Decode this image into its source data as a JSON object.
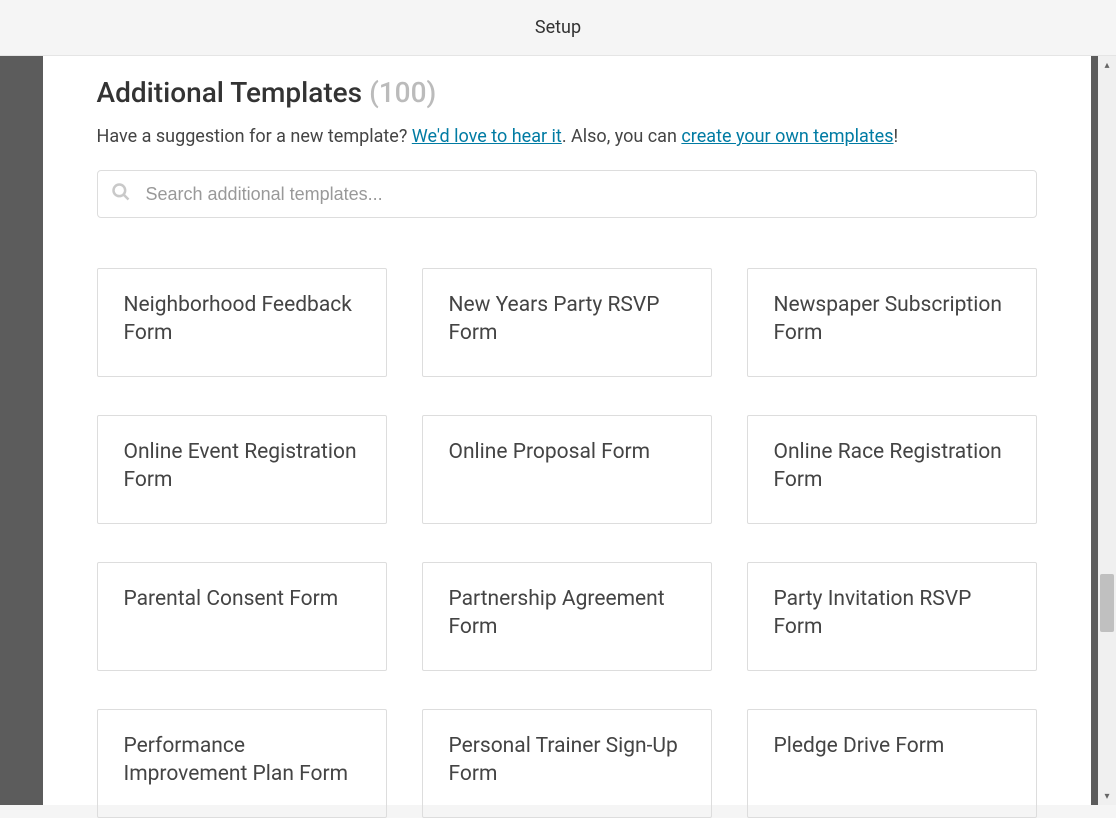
{
  "header": {
    "title": "Setup"
  },
  "page": {
    "heading": "Additional Templates",
    "count": "(100)",
    "subtitle_prefix": "Have a suggestion for a new template? ",
    "subtitle_link1": "We'd love to hear it",
    "subtitle_mid": ". Also, you can ",
    "subtitle_link2": "create your own templates",
    "subtitle_suffix": "!"
  },
  "search": {
    "placeholder": "Search additional templates..."
  },
  "templates": [
    {
      "title": "Neighborhood Feedback Form"
    },
    {
      "title": "New Years Party RSVP Form"
    },
    {
      "title": "Newspaper Subscription Form"
    },
    {
      "title": "Online Event Registration Form"
    },
    {
      "title": "Online Proposal Form"
    },
    {
      "title": "Online Race Registration Form"
    },
    {
      "title": "Parental Consent Form"
    },
    {
      "title": "Partnership Agreement Form"
    },
    {
      "title": "Party Invitation RSVP Form"
    },
    {
      "title": "Performance Improvement Plan Form"
    },
    {
      "title": "Personal Trainer Sign-Up Form"
    },
    {
      "title": "Pledge Drive Form"
    }
  ]
}
